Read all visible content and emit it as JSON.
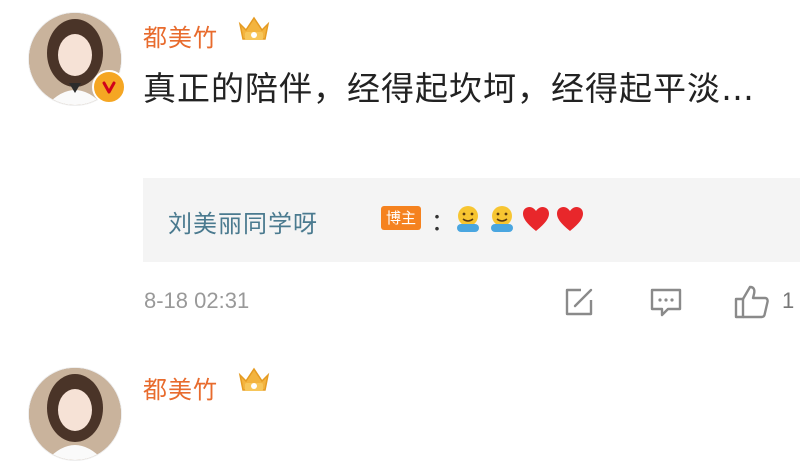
{
  "comments": [
    {
      "author": "都美竹",
      "text": "真正的陪伴，经得起坎坷，经得起平淡…",
      "reply": {
        "author": "刘美丽同学呀",
        "badge": "博主",
        "separator": "：",
        "emojis": [
          "hugging-face-icon",
          "hugging-face-icon",
          "red-heart-icon",
          "red-heart-icon"
        ]
      },
      "timestamp": "8-18 02:31",
      "actions": {
        "like_count": "1"
      }
    },
    {
      "author": "都美竹"
    }
  ],
  "colors": {
    "author_name": "#e86b2d",
    "reply_name": "#4a7a8f",
    "host_badge": "#f5821f",
    "heart": "#e8272b",
    "timestamp": "#999999"
  }
}
